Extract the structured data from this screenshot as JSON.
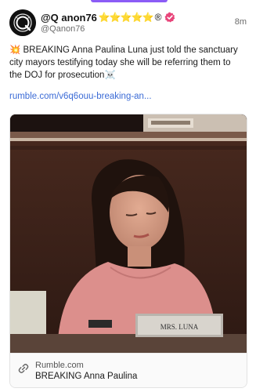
{
  "post": {
    "display_name": "@Q anon76",
    "stars": "⭐⭐⭐⭐⭐",
    "registered_mark": "®",
    "handle": "@Qanon76",
    "time_ago": "8m",
    "text": "💥 BREAKING Anna Paulina Luna just told the sanctuary city mayors testifying today she will be referring them to the DOJ for prosecution☠️",
    "link": "rumble.com/v6q6ouu-breaking-an...",
    "card": {
      "domain": "Rumble.com",
      "title": "BREAKING Anna Paulina",
      "nameplate": "MRS. LUNA"
    }
  },
  "colors": {
    "accent": "#8b5cf6",
    "link": "#3b6bd6",
    "verified_badge": "#e8457a",
    "stars": "#f4b400"
  },
  "icons": [
    "q-avatar-icon",
    "verified-badge-icon",
    "link-icon"
  ]
}
